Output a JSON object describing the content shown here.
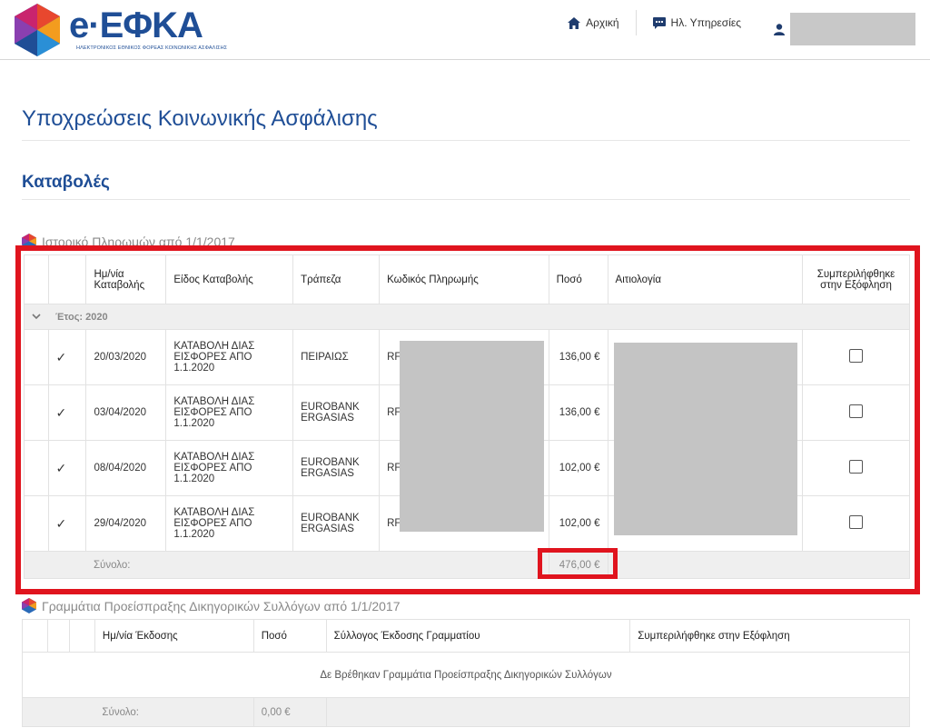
{
  "header": {
    "logo_text": "e·ΕΦΚΑ",
    "logo_subtitle": "ΗΛΕΚΤΡΟΝΙΚΟΣ ΕΘΝΙΚΟΣ ΦΟΡΕΑΣ ΚΟΙΝΩΝΙΚΗΣ ΑΣΦΑΛΙΣΗΣ",
    "nav": [
      {
        "label": "Αρχική",
        "icon": "home-icon"
      },
      {
        "label": "Ηλ. Υπηρεσίες",
        "icon": "chat-icon"
      }
    ],
    "user_icon": "user-icon"
  },
  "page": {
    "title": "Υποχρεώσεις Κοινωνικής Ασφάλισης",
    "section": "Καταβολές"
  },
  "payments": {
    "heading": "Ιστορικό Πληρωμών από 1/1/2017",
    "columns": [
      "Ημ/νία Καταβολής",
      "Είδος Καταβολής",
      "Τράπεζα",
      "Κωδικός Πληρωμής",
      "Ποσό",
      "Αιτιολογία",
      "Συμπεριλήφθηκε στην Εξόφληση"
    ],
    "year_group": "Έτος: 2020",
    "rows": [
      {
        "date": "20/03/2020",
        "type": "ΚΑΤΑΒΟΛΗ ΔΙΑΣ ΕΙΣΦΟΡΕΣ ΑΠΟ 1.1.2020",
        "bank": "ΠΕΙΡΑΙΩΣ",
        "code": "RF",
        "amount": "136,00 €"
      },
      {
        "date": "03/04/2020",
        "type": "ΚΑΤΑΒΟΛΗ ΔΙΑΣ ΕΙΣΦΟΡΕΣ ΑΠΟ 1.1.2020",
        "bank": "EUROBANK ERGASIAS",
        "code": "RF",
        "amount": "136,00 €"
      },
      {
        "date": "08/04/2020",
        "type": "ΚΑΤΑΒΟΛΗ ΔΙΑΣ ΕΙΣΦΟΡΕΣ ΑΠΟ 1.1.2020",
        "bank": "EUROBANK ERGASIAS",
        "code": "RF",
        "amount": "102,00 €"
      },
      {
        "date": "29/04/2020",
        "type": "ΚΑΤΑΒΟΛΗ ΔΙΑΣ ΕΙΣΦΟΡΕΣ ΑΠΟ 1.1.2020",
        "bank": "EUROBANK ERGASIAS",
        "code": "RF",
        "amount": "102,00 €"
      }
    ],
    "total_label": "Σύνολο:",
    "total_value": "476,00 €"
  },
  "notes": {
    "heading": "Γραμμάτια Προείσπραξης Δικηγορικών Συλλόγων από 1/1/2017",
    "columns": [
      "Ημ/νία Έκδοσης",
      "Ποσό",
      "Σύλλογος Έκδοσης Γραμματίου",
      "Συμπεριλήφθηκε στην Εξόφληση"
    ],
    "empty_message": "Δε Βρέθηκαν Γραμμάτια Προείσπραξης Δικηγορικών Συλλόγων",
    "total_label": "Σύνολο:",
    "total_value": "0,00 €"
  },
  "colors": {
    "brand_blue": "#1f4e96",
    "highlight_red": "#e0141e",
    "check_green": "#3aa57a"
  }
}
